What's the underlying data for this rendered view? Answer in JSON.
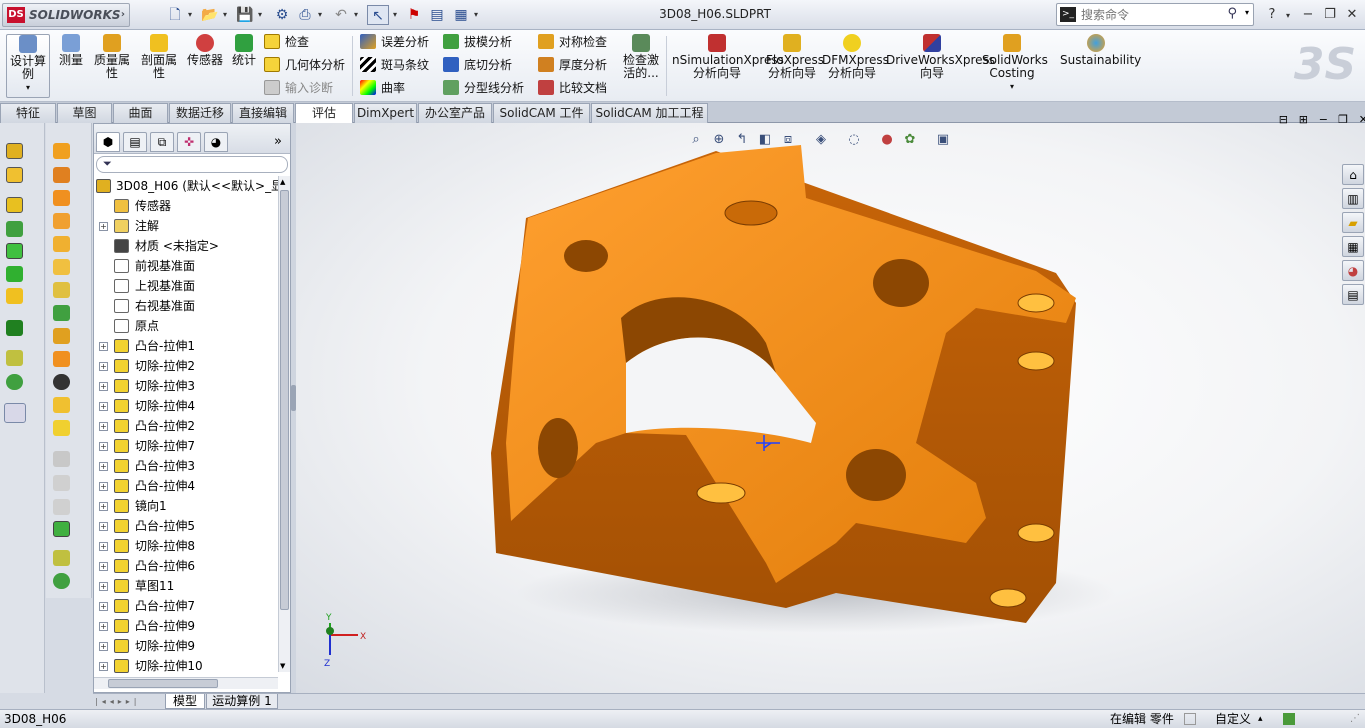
{
  "app": {
    "brand": "SOLIDWORKS",
    "document_title": "3D08_H06.SLDPRT"
  },
  "search": {
    "placeholder": "搜索命令"
  },
  "ribbon": {
    "big_buttons": [
      {
        "id": "design-study",
        "label": "设计算例"
      },
      {
        "id": "measure",
        "label": "测量"
      },
      {
        "id": "mass-properties",
        "label": "质量属性"
      },
      {
        "id": "section-properties",
        "label": "剖面属性"
      },
      {
        "id": "sensor",
        "label": "传感器"
      },
      {
        "id": "statistics",
        "label": "统计"
      }
    ],
    "col1": [
      "检查",
      "几何体分析",
      "输入诊断"
    ],
    "col2": [
      "误差分析",
      "斑马条纹",
      "曲率"
    ],
    "col3": [
      "拔模分析",
      "底切分析",
      "分型线分析"
    ],
    "col4": [
      "对称检查",
      "厚度分析",
      "比较文档"
    ],
    "check_active": "检查激活的...",
    "addins": [
      {
        "id": "simulationxpress",
        "label": "nSimulationXpress 分析向导"
      },
      {
        "id": "floxpress",
        "label": "FloXpress 分析向导"
      },
      {
        "id": "dfmxpress",
        "label": "DFMXpress 分析向导"
      },
      {
        "id": "driveworksxpress",
        "label": "DriveWorksXpress 向导"
      },
      {
        "id": "costing",
        "label": "SolidWorks Costing"
      },
      {
        "id": "sustainability",
        "label": "Sustainability"
      }
    ]
  },
  "tabs": [
    "特征",
    "草图",
    "曲面",
    "数据迁移",
    "直接编辑",
    "评估",
    "DimXpert",
    "办公室产品",
    "SolidCAM 工件",
    "SolidCAM 加工工程"
  ],
  "active_tab": "评估",
  "tree": {
    "root": "3D08_H06  (默认<<默认>_显",
    "items": [
      "传感器",
      "注解",
      "材质 <未指定>",
      "前视基准面",
      "上视基准面",
      "右视基准面",
      "原点",
      "凸台-拉伸1",
      "切除-拉伸2",
      "切除-拉伸3",
      "切除-拉伸4",
      "凸台-拉伸2",
      "切除-拉伸7",
      "凸台-拉伸3",
      "凸台-拉伸4",
      "镜向1",
      "凸台-拉伸5",
      "切除-拉伸8",
      "凸台-拉伸6",
      "草图11",
      "凸台-拉伸7",
      "凸台-拉伸9",
      "切除-拉伸9",
      "切除-拉伸10"
    ]
  },
  "bottom_tabs": [
    "模型",
    "运动算例 1"
  ],
  "status": {
    "doc": "3D08_H06",
    "mode": "在编辑 零件",
    "custom": "自定义"
  },
  "triad": {
    "x": "X",
    "y": "Y",
    "z": "Z"
  },
  "colors": {
    "part": "#f08a12",
    "accent": "#2a4d8f"
  }
}
